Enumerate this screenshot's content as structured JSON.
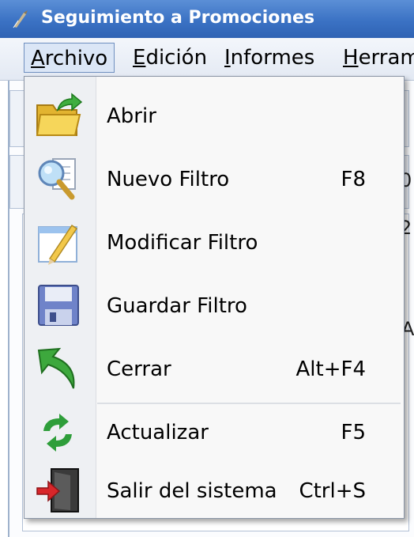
{
  "window": {
    "title": "Seguimiento a Promociones"
  },
  "menubar": {
    "items": [
      {
        "label": "Archivo",
        "mnemonic": "A",
        "rest": "rchivo",
        "active": true
      },
      {
        "label": "Edición",
        "mnemonic": "E",
        "rest": "dición"
      },
      {
        "label": "Informes",
        "mnemonic": "I",
        "rest": "nformes"
      },
      {
        "label": "Herram",
        "mnemonic": "H",
        "rest": "erram"
      }
    ]
  },
  "background_fragments": [
    "0",
    "2",
    "A"
  ],
  "dropdown": {
    "items": [
      {
        "label": "Abrir",
        "shortcut": "",
        "icon": "folder-open-icon"
      },
      {
        "label": "Nuevo Filtro",
        "shortcut": "F8",
        "icon": "magnifier-document-icon"
      },
      {
        "label": "Modificar Filtro",
        "shortcut": "",
        "icon": "pencil-window-icon"
      },
      {
        "label": "Guardar Filtro",
        "shortcut": "",
        "icon": "floppy-disk-icon"
      },
      {
        "label": "Cerrar",
        "shortcut": "Alt+F4",
        "icon": "green-back-arrow-icon"
      },
      {
        "label": "Actualizar",
        "shortcut": "F5",
        "icon": "refresh-icon"
      },
      {
        "label": "Salir del sistema",
        "shortcut": "Ctrl+S",
        "icon": "exit-door-icon"
      }
    ]
  }
}
